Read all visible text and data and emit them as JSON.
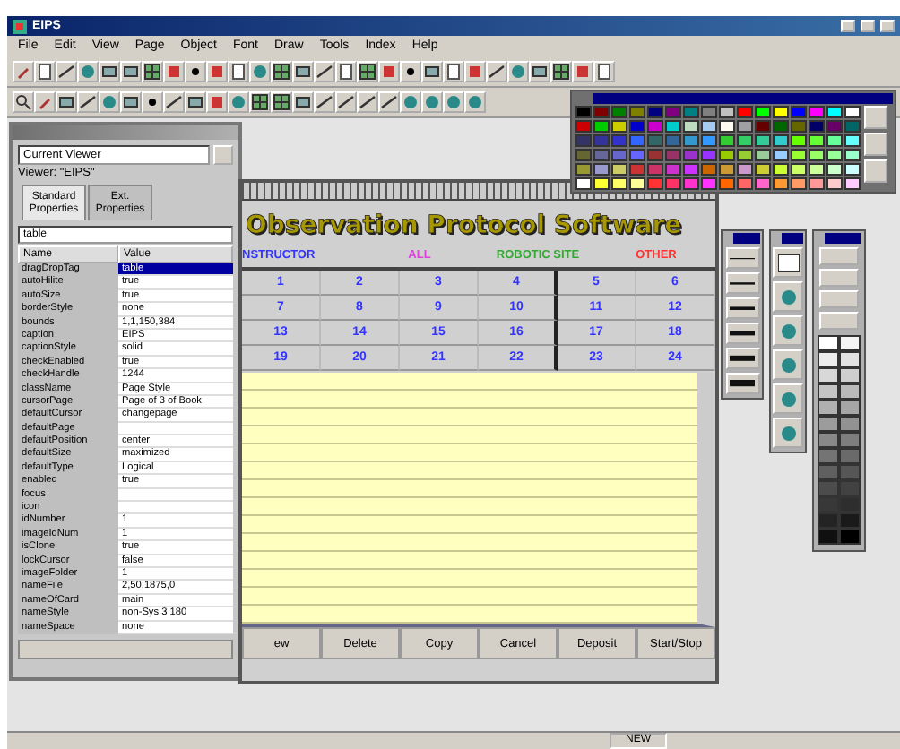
{
  "window": {
    "title": "EIPS"
  },
  "menu": [
    "File",
    "Edit",
    "View",
    "Page",
    "Object",
    "Font",
    "Draw",
    "Tools",
    "Index",
    "Help"
  ],
  "properties_palette": {
    "object_menu": "Current Viewer",
    "viewer_label": "Viewer: \"EIPS\"",
    "tabs": [
      {
        "label": "Standard Properties",
        "selected": true
      },
      {
        "label": "Ext. Properties",
        "selected": false
      }
    ],
    "filter": "table",
    "columns": [
      "Name",
      "Value"
    ],
    "rows": [
      {
        "name": "dragDropTag",
        "value": "table",
        "selected": true
      },
      {
        "name": "autoHilite",
        "value": "true",
        "selected": false
      },
      {
        "name": "autoSize",
        "value": "true",
        "selected": false
      },
      {
        "name": "borderStyle",
        "value": "none",
        "selected": false
      },
      {
        "name": "bounds",
        "value": "1,1,150,384",
        "selected": false
      },
      {
        "name": "caption",
        "value": "EIPS",
        "selected": false
      },
      {
        "name": "captionStyle",
        "value": "solid",
        "selected": false
      },
      {
        "name": "checkEnabled",
        "value": "true",
        "selected": false
      },
      {
        "name": "checkHandle",
        "value": "1244",
        "selected": false
      },
      {
        "name": "className",
        "value": "Page Style",
        "selected": false
      },
      {
        "name": "cursorPage",
        "value": "Page of 3 of Book",
        "selected": false
      },
      {
        "name": "defaultCursor",
        "value": "changepage",
        "selected": false
      },
      {
        "name": "defaultPage",
        "selected": false
      },
      {
        "name": "defaultPosition",
        "value": "center",
        "selected": false
      },
      {
        "name": "defaultSize",
        "value": "maximized",
        "selected": false
      },
      {
        "name": "defaultType",
        "value": "Logical",
        "selected": false
      },
      {
        "name": "enabled",
        "value": "true",
        "selected": false
      },
      {
        "name": "focus",
        "selected": false
      },
      {
        "name": "icon",
        "selected": false
      },
      {
        "name": "idNumber",
        "value": "1",
        "selected": false
      },
      {
        "name": "imageIdNum",
        "value": "1",
        "selected": false
      },
      {
        "name": "isClone",
        "value": "true",
        "selected": false
      },
      {
        "name": "lockCursor",
        "value": "false",
        "selected": false
      },
      {
        "name": "imageFolder",
        "value": "1",
        "selected": false
      },
      {
        "name": "nameFile",
        "value": "2,50,1875,0",
        "selected": false
      },
      {
        "name": "nameOfCard",
        "value": "main",
        "selected": false
      },
      {
        "name": "nameStyle",
        "value": "non-Sys 3 180",
        "selected": false
      },
      {
        "name": "nameSpace",
        "value": "none",
        "selected": false
      }
    ]
  },
  "card": {
    "title": "Observation Protocol Software",
    "headers": [
      {
        "label": "NSTRUCTOR",
        "color": "#3333ff"
      },
      {
        "label": "ALL",
        "color": "#e040e0"
      },
      {
        "label": "ROBOTIC SITE",
        "color": "#33aa33"
      },
      {
        "label": "OTHER",
        "color": "#ff3333"
      }
    ],
    "numbers": [
      "1",
      "2",
      "3",
      "4",
      "5",
      "6",
      "7",
      "8",
      "9",
      "10",
      "11",
      "12",
      "13",
      "14",
      "15",
      "16",
      "17",
      "18",
      "19",
      "20",
      "21",
      "22",
      "23",
      "24"
    ],
    "buttons": [
      "ew",
      "Delete",
      "Copy",
      "Cancel",
      "Deposit",
      "Start/Stop"
    ]
  },
  "color_palette": {
    "rows": [
      [
        {
          "color": "#000000"
        },
        {
          "color": "#800000"
        },
        {
          "color": "#008000"
        },
        {
          "color": "#808000"
        },
        {
          "color": "#000080"
        },
        {
          "color": "#800080"
        },
        {
          "color": "#008080"
        },
        {
          "color": "#808080"
        },
        {
          "color": "#c0c0c0"
        },
        {
          "color": "#ff0000"
        },
        {
          "color": "#00ff00"
        },
        {
          "color": "#ffff00"
        },
        {
          "color": "#0000ff"
        },
        {
          "color": "#ff00ff"
        },
        {
          "color": "#00ffff"
        },
        {
          "color": "#ffffff"
        }
      ],
      [
        {
          "color": "#cc0000"
        },
        {
          "color": "#00cc00"
        },
        {
          "color": "#cccc00"
        },
        {
          "color": "#0000cc"
        },
        {
          "color": "#cc00cc"
        },
        {
          "color": "#00cccc"
        },
        {
          "color": "#c0dcc0"
        },
        {
          "color": "#a6caf0"
        },
        {
          "color": "#fffbf0"
        },
        {
          "color": "#a0a0a4"
        },
        {
          "color": "#660000"
        },
        {
          "color": "#006600"
        },
        {
          "color": "#666600"
        },
        {
          "color": "#000066"
        },
        {
          "color": "#660066"
        },
        {
          "color": "#006666"
        }
      ],
      [
        {
          "color": "#333366"
        },
        {
          "color": "#333399"
        },
        {
          "color": "#3333cc"
        },
        {
          "color": "#3366ff"
        },
        {
          "color": "#336666"
        },
        {
          "color": "#336699"
        },
        {
          "color": "#3399cc"
        },
        {
          "color": "#3399ff"
        },
        {
          "color": "#33cc33"
        },
        {
          "color": "#33cc66"
        },
        {
          "color": "#33cc99"
        },
        {
          "color": "#33cccc"
        },
        {
          "color": "#66ff00"
        },
        {
          "color": "#66ff33"
        },
        {
          "color": "#66ff99"
        },
        {
          "color": "#66ffff"
        }
      ],
      [
        {
          "color": "#666633"
        },
        {
          "color": "#666699"
        },
        {
          "color": "#6666cc"
        },
        {
          "color": "#6666ff"
        },
        {
          "color": "#993333"
        },
        {
          "color": "#993366"
        },
        {
          "color": "#9933cc"
        },
        {
          "color": "#9933ff"
        },
        {
          "color": "#99cc00"
        },
        {
          "color": "#99cc33"
        },
        {
          "color": "#99cc99"
        },
        {
          "color": "#99ccff"
        },
        {
          "color": "#99ff33"
        },
        {
          "color": "#99ff66"
        },
        {
          "color": "#99ff99"
        },
        {
          "color": "#99ffcc"
        }
      ],
      [
        {
          "color": "#999933"
        },
        {
          "color": "#9999cc"
        },
        {
          "color": "#cccc66"
        },
        {
          "color": "#cc3333"
        },
        {
          "color": "#cc3366"
        },
        {
          "color": "#cc33cc"
        },
        {
          "color": "#cc33ff"
        },
        {
          "color": "#cc6600"
        },
        {
          "color": "#cc9933"
        },
        {
          "color": "#cc99cc"
        },
        {
          "color": "#cccc33"
        },
        {
          "color": "#ccff33"
        },
        {
          "color": "#ccff66"
        },
        {
          "color": "#ccff99"
        },
        {
          "color": "#ccffcc"
        },
        {
          "color": "#ccffff"
        }
      ],
      [
        {
          "color": "#ffffff"
        },
        {
          "color": "#ffff33"
        },
        {
          "color": "#ffff66"
        },
        {
          "color": "#ffff99"
        },
        {
          "color": "#ff3333"
        },
        {
          "color": "#ff3366"
        },
        {
          "color": "#ff33cc"
        },
        {
          "color": "#ff33ff"
        },
        {
          "color": "#ff6600"
        },
        {
          "color": "#ff6666"
        },
        {
          "color": "#ff66cc"
        },
        {
          "color": "#ff9933"
        },
        {
          "color": "#ff9966"
        },
        {
          "color": "#ff9999"
        },
        {
          "color": "#ffcccc"
        },
        {
          "color": "#ffccff"
        }
      ]
    ]
  },
  "gray_palette": {
    "swatches": [
      {
        "color": "#ffffff"
      },
      {
        "color": "#f4f4f4"
      },
      {
        "color": "#ececec"
      },
      {
        "color": "#e2e2e2"
      },
      {
        "color": "#d8d8d8"
      },
      {
        "color": "#cecece"
      },
      {
        "color": "#c4c4c4"
      },
      {
        "color": "#bababa"
      },
      {
        "color": "#b0b0b0"
      },
      {
        "color": "#a6a6a6"
      },
      {
        "color": "#9c9c9c"
      },
      {
        "color": "#929292"
      },
      {
        "color": "#888888"
      },
      {
        "color": "#7e7e7e"
      },
      {
        "color": "#747474"
      },
      {
        "color": "#6a6a6a"
      },
      {
        "color": "#606060"
      },
      {
        "color": "#565656"
      },
      {
        "color": "#4c4c4c"
      },
      {
        "color": "#424242"
      },
      {
        "color": "#383838"
      },
      {
        "color": "#2e2e2e"
      },
      {
        "color": "#242424"
      },
      {
        "color": "#1a1a1a"
      },
      {
        "color": "#101010"
      },
      {
        "color": "#000000"
      }
    ]
  },
  "status_bar": [
    "NEW"
  ]
}
